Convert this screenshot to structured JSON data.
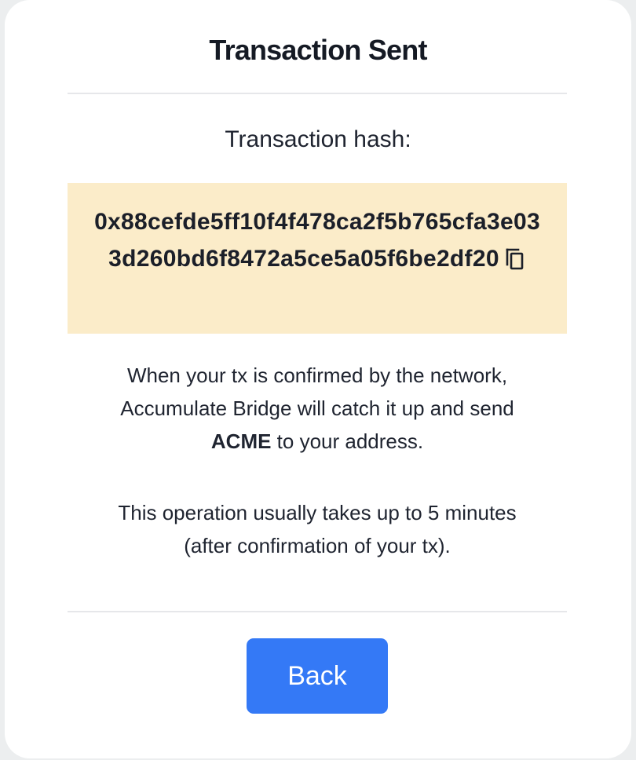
{
  "dialog": {
    "title": "Transaction Sent",
    "hash_label": "Transaction hash:",
    "hash_value": "0x88cefde5ff10f4f478ca2f5b765cfa3e033d260bd6f8472a5ce5a05f6be2df20",
    "copy_icon": "copy-icon",
    "message_line1": "When your tx is confirmed by the network,",
    "message_line2": "Accumulate Bridge will catch it up and send",
    "message_token": "ACME",
    "message_line3_rest": " to your address.",
    "time_line1": "This operation usually takes up to 5 minutes",
    "time_line2": "(after confirmation of your tx).",
    "back_label": "Back"
  },
  "colors": {
    "hash_background": "#fbecc9",
    "button_primary": "#3479f6"
  }
}
